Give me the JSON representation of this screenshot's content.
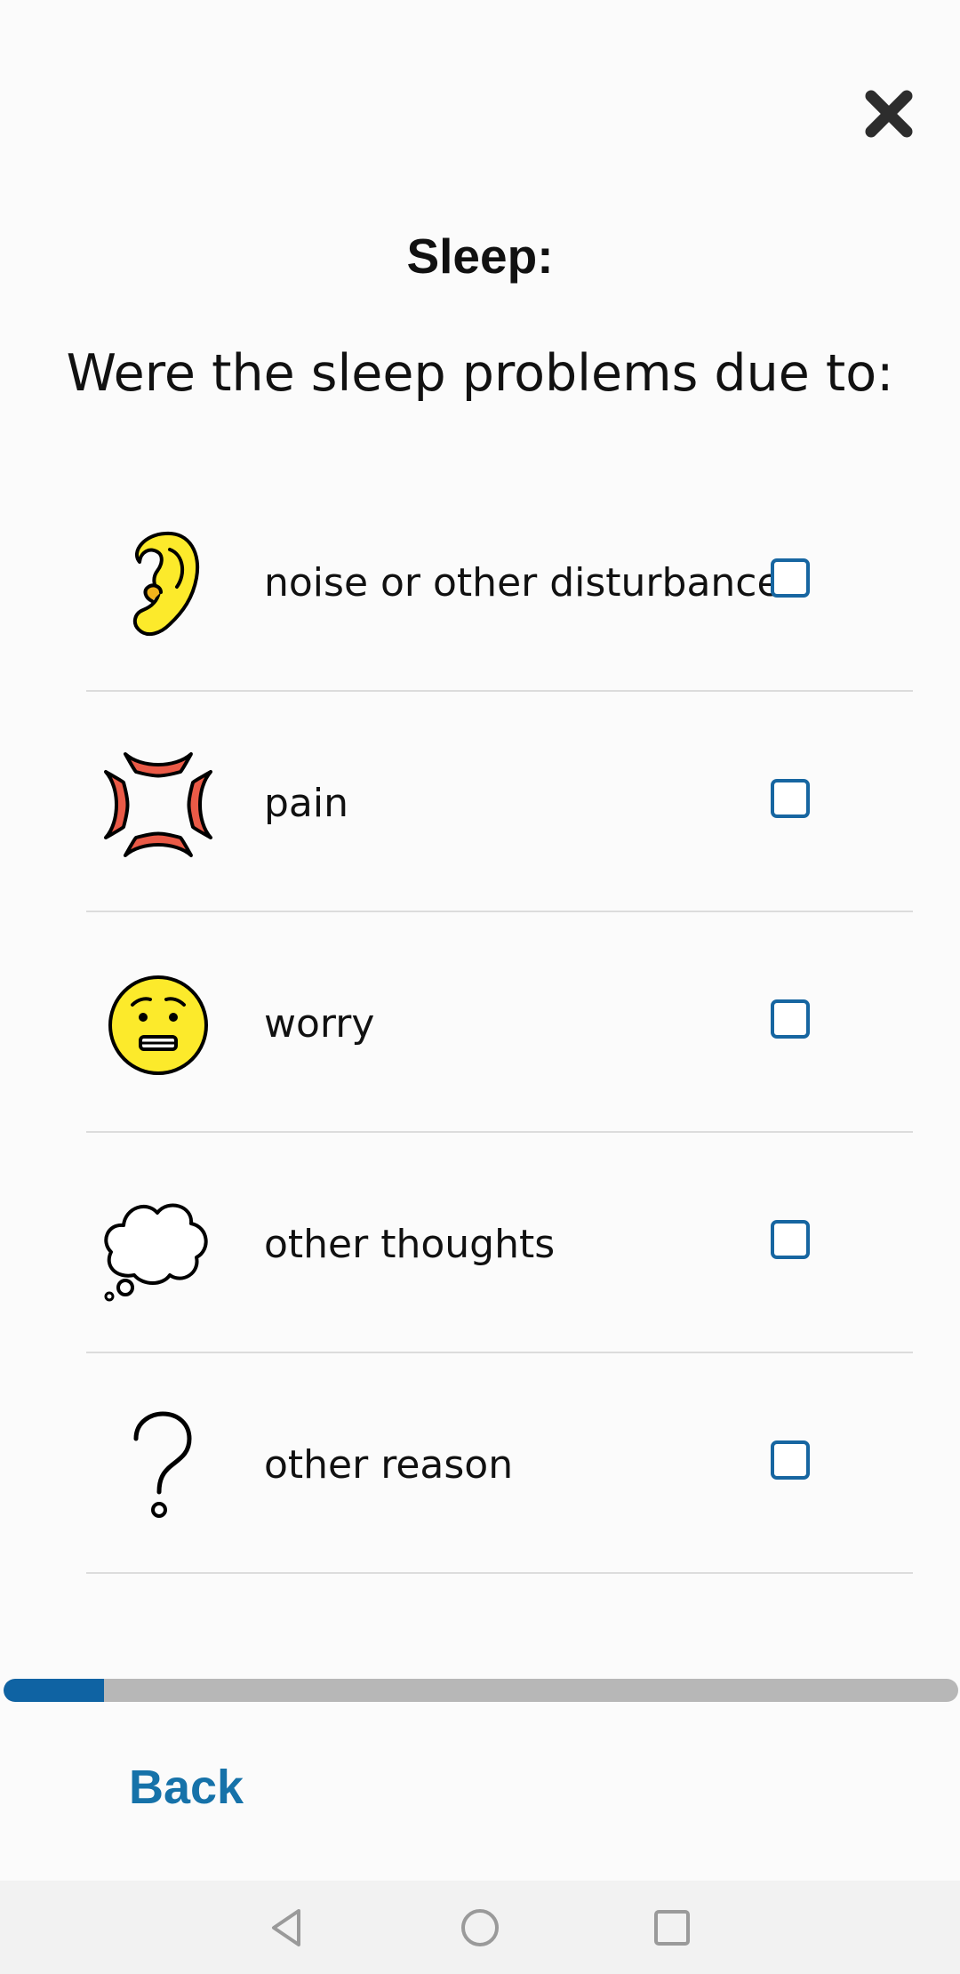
{
  "header": {
    "close_icon": "close-icon",
    "title": "Sleep:",
    "question": "Were the sleep problems due to:"
  },
  "options": [
    {
      "label": "noise or other disturbances",
      "icon": "ear-icon",
      "checked": false
    },
    {
      "label": "pain",
      "icon": "anger-symbol-icon",
      "checked": false
    },
    {
      "label": "worry",
      "icon": "worried-face-icon",
      "checked": false
    },
    {
      "label": "other thoughts",
      "icon": "thought-bubble-icon",
      "checked": false
    },
    {
      "label": "other reason",
      "icon": "question-mark-icon",
      "checked": false
    }
  ],
  "progress": {
    "fraction": 0.105
  },
  "footer": {
    "back_label": "Back"
  },
  "system_nav": {
    "back_icon": "nav-back-icon",
    "home_icon": "nav-home-icon",
    "recents_icon": "nav-recents-icon"
  },
  "colors": {
    "accent": "#1672a9",
    "checkbox_border": "#1766a1",
    "progress_fill": "#0f63a3",
    "progress_track": "#b7b7b7",
    "emoji_yellow": "#fcea2b",
    "anger_red": "#ea5a47"
  }
}
